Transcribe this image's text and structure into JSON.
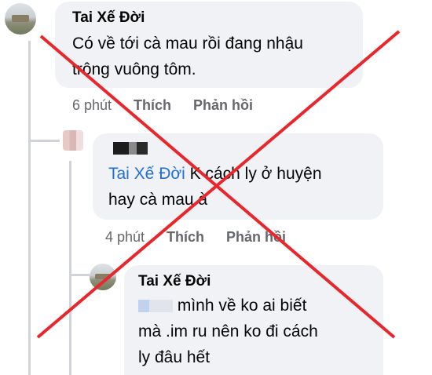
{
  "comments": [
    {
      "author": "Tai Xế Đời",
      "text_line1": "Có về tới cà mau rồi đang nhậu",
      "text_line2": "trông vuông tôm.",
      "time": "6 phút",
      "like": "Thích",
      "reply": "Phản hồi"
    },
    {
      "mention": "Tai Xế Đời",
      "text_line1": " K cách ly ở huyện",
      "text_line2": "hay cà mau à",
      "time": "4 phút",
      "like": "Thích",
      "reply": "Phản hồi"
    },
    {
      "author": "Tai Xế Đời",
      "text_line1": " mình về ko ai biết",
      "text_line2": "mà .im ru nên ko đi cách",
      "text_line3": "ly đâu hết"
    }
  ],
  "colors": {
    "cross": "#e8262b",
    "mention": "#216fdb",
    "bubble": "#f0f2f5"
  }
}
